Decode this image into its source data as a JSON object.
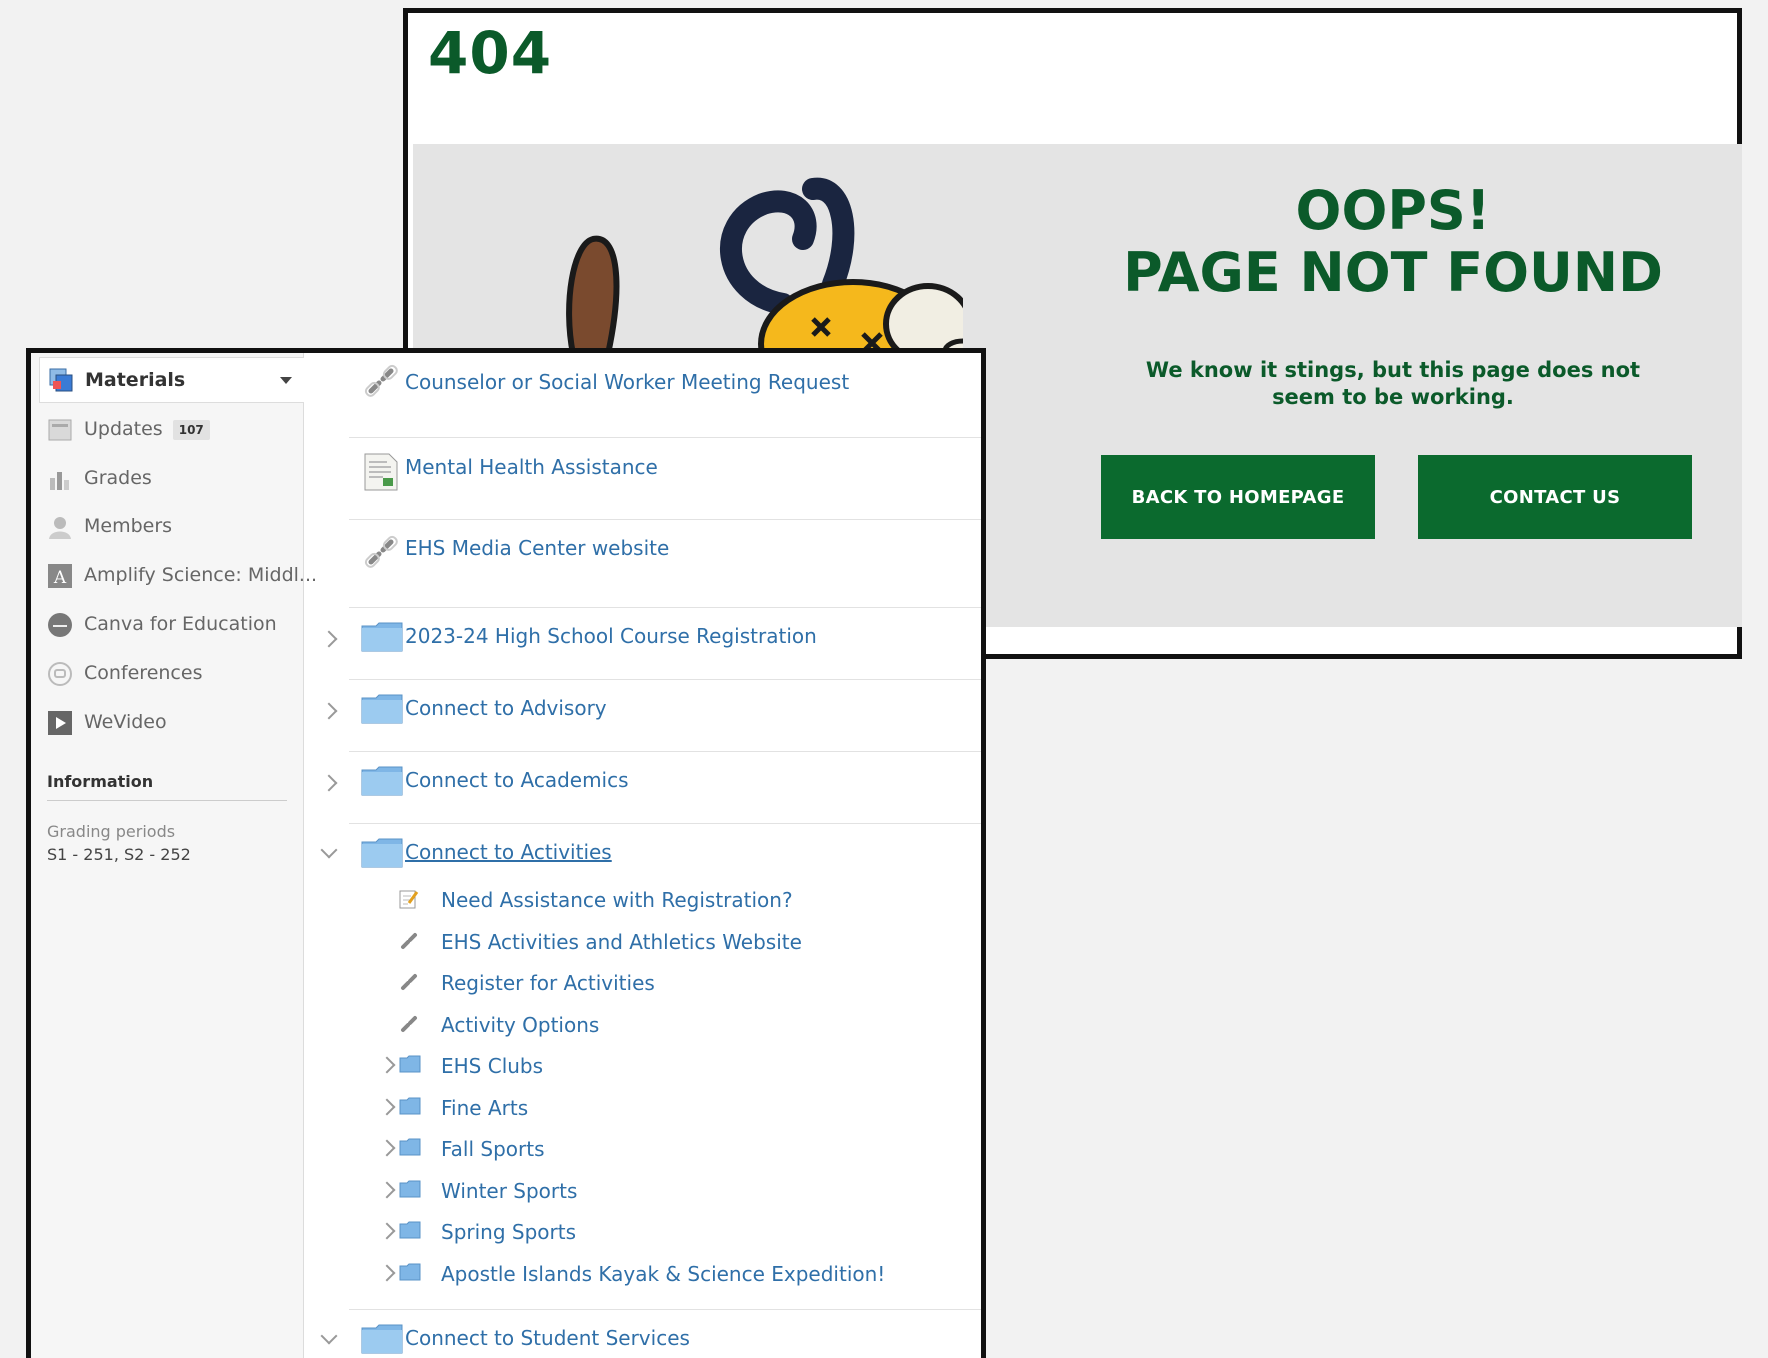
{
  "error_page": {
    "code": "404",
    "title_line1": "OOPS!",
    "title_line2": "PAGE NOT FOUND",
    "message": "We know it stings, but this page does not seem to be working.",
    "buttons": {
      "home": "BACK TO HOMEPAGE",
      "contact": "CONTACT US"
    },
    "colors": {
      "brand_green": "#0b6a2e",
      "text_green": "#0b5a2a",
      "panel_gray": "#e4e4e4"
    }
  },
  "sidebar": {
    "materials_label": "Materials",
    "items": [
      {
        "label": "Updates",
        "badge": "107",
        "icon": "updates-icon"
      },
      {
        "label": "Grades",
        "icon": "grades-icon"
      },
      {
        "label": "Members",
        "icon": "members-icon"
      },
      {
        "label": "Amplify Science: Middl...",
        "icon": "amplify-icon"
      },
      {
        "label": "Canva for Education",
        "icon": "canva-icon"
      },
      {
        "label": "Conferences",
        "icon": "conferences-icon"
      },
      {
        "label": "WeVideo",
        "icon": "wevideo-icon"
      }
    ],
    "information": {
      "heading": "Information",
      "grading_label": "Grading periods",
      "grading_value": "S1 - 251, S2 - 252"
    }
  },
  "materials": {
    "top_items": [
      {
        "label": "Counselor or Social Worker Meeting Request",
        "icon": "link-icon"
      },
      {
        "label": "Mental Health Assistance",
        "icon": "document-icon"
      },
      {
        "label": "EHS Media Center website",
        "icon": "link-icon"
      }
    ],
    "folders": [
      {
        "label": "2023-24 High School Course Registration",
        "state": "collapsed"
      },
      {
        "label": "Connect to Advisory",
        "state": "collapsed"
      },
      {
        "label": "Connect to Academics",
        "state": "collapsed"
      },
      {
        "label": "Connect to Activities",
        "state": "expanded"
      },
      {
        "label": "Connect to Student Services",
        "state": "expanded"
      }
    ],
    "activities_children": [
      {
        "label": "Need Assistance with Registration?",
        "icon": "assignment-icon"
      },
      {
        "label": "EHS Activities and Athletics Website",
        "icon": "link-icon"
      },
      {
        "label": "Register for Activities",
        "icon": "link-icon"
      },
      {
        "label": "Activity Options",
        "icon": "link-icon"
      },
      {
        "label": "EHS Clubs",
        "icon": "folder-icon"
      },
      {
        "label": "Fine Arts",
        "icon": "folder-icon"
      },
      {
        "label": "Fall Sports",
        "icon": "folder-icon"
      },
      {
        "label": "Winter Sports",
        "icon": "folder-icon"
      },
      {
        "label": "Spring Sports",
        "icon": "folder-icon"
      },
      {
        "label": "Apostle Islands Kayak & Science Expedition!",
        "icon": "folder-icon"
      }
    ],
    "colors": {
      "link": "#2f6fa8",
      "folder": "#7fb6e6"
    }
  }
}
